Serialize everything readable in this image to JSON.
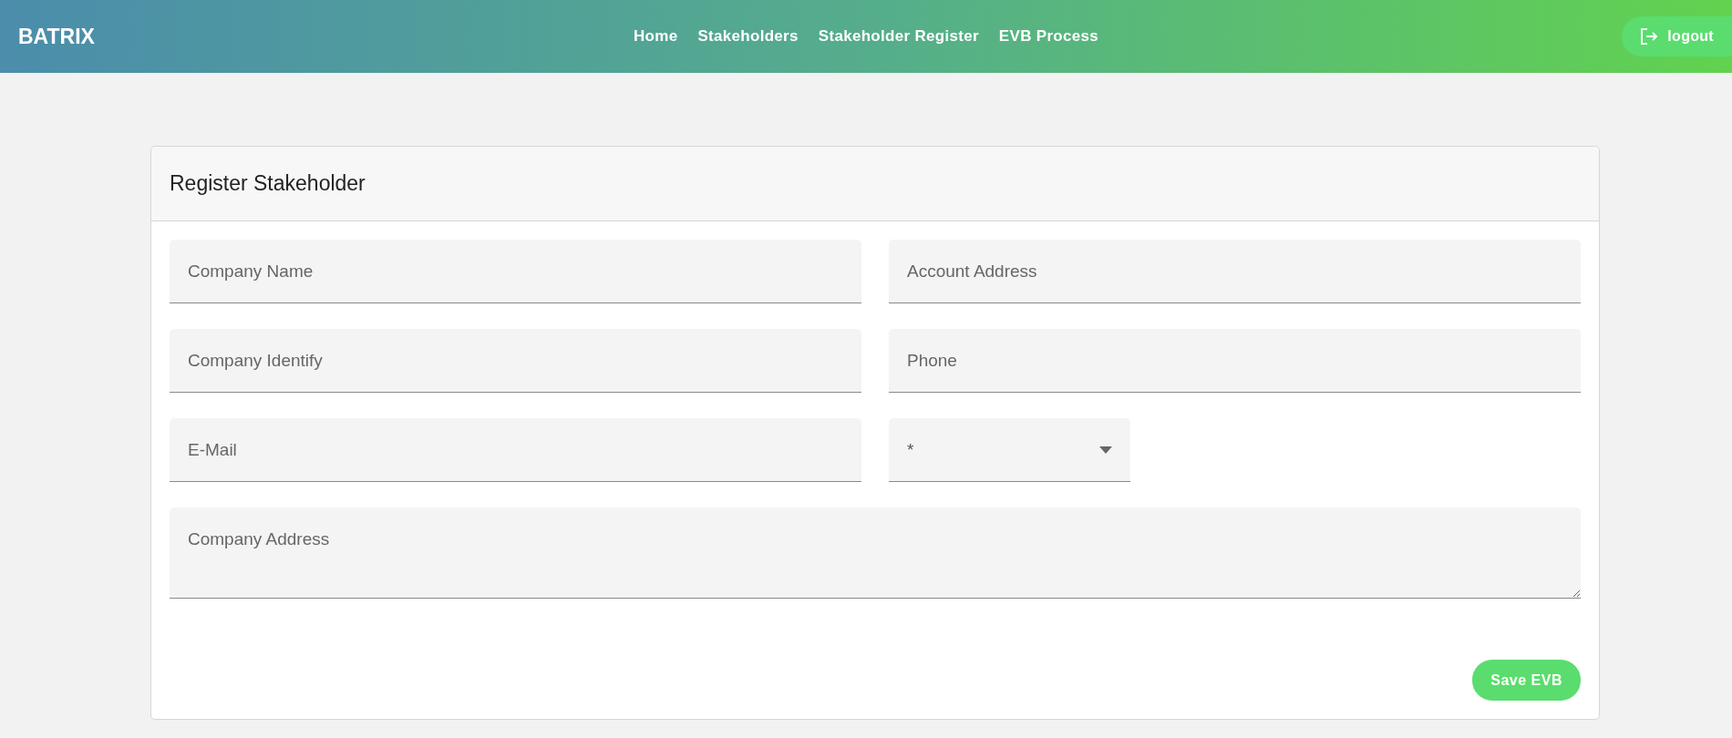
{
  "header": {
    "brand": "BATRIX",
    "nav": [
      {
        "label": "Home"
      },
      {
        "label": "Stakeholders"
      },
      {
        "label": "Stakeholder Register"
      },
      {
        "label": "EVB Process"
      }
    ],
    "logout": "logout"
  },
  "form": {
    "title": "Register Stakeholder",
    "fields": [
      {
        "kind": "text",
        "placeholder": "Company Name"
      },
      {
        "kind": "text",
        "placeholder": "Account Address"
      },
      {
        "kind": "text",
        "placeholder": "Company Identify"
      },
      {
        "kind": "text",
        "placeholder": "Phone"
      },
      {
        "kind": "text",
        "placeholder": "E-Mail"
      },
      {
        "kind": "select",
        "label": "*"
      },
      {
        "kind": "textarea",
        "placeholder": "Company Address"
      }
    ],
    "submit": "Save EVB"
  }
}
